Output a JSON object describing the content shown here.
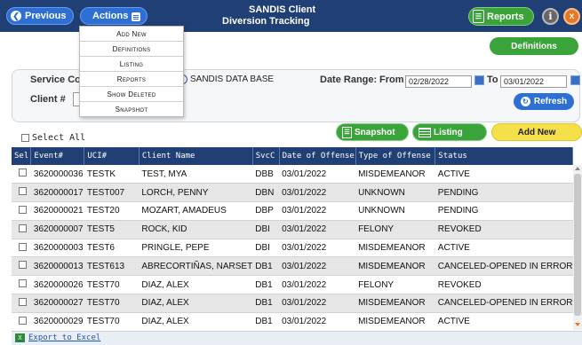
{
  "header": {
    "previous_label": "Previous",
    "actions_label": "Actions",
    "title_line1": "SANDIS Client",
    "title_line2": "Diversion Tracking",
    "reports_label": "Reports",
    "info_label": "i",
    "close_label": "x"
  },
  "actions_menu": {
    "items": [
      "Add New",
      "Definitions",
      "Listing",
      "Reports",
      "Show Deleted",
      "Snapshot"
    ]
  },
  "definitions_label": "Definitions",
  "filters": {
    "service_code_label": "Service Coo",
    "database_label": "SANDIS DATA BASE",
    "date_range_label": "Date Range:",
    "from_label": "From",
    "from_value": "02/28/2022",
    "to_label": "To",
    "to_value": "03/01/2022",
    "client_label": "Client #",
    "refresh_label": "Refresh"
  },
  "toolbar": {
    "select_all_label": "Select All",
    "snapshot_label": "Snapshot",
    "listing_label": "Listing",
    "add_new_label": "Add New"
  },
  "table": {
    "columns": [
      "Sel",
      "Event#",
      "UCI#",
      "Client Name",
      "SvcC",
      "Date of Offense",
      "Type of Offense",
      "Status"
    ],
    "rows": [
      [
        "3620000036",
        "TESTK",
        "TEST, MYA",
        "DBB",
        "03/01/2022",
        "MISDEMEANOR",
        "ACTIVE"
      ],
      [
        "3620000017",
        "TEST007",
        "LORCH, PENNY",
        "DBN",
        "03/01/2022",
        "UNKNOWN",
        "PENDING"
      ],
      [
        "3620000021",
        "TEST20",
        "MOZART, AMADEUS",
        "DBP",
        "03/01/2022",
        "UNKNOWN",
        "PENDING"
      ],
      [
        "3620000007",
        "TEST5",
        "ROCK, KID",
        "DBI",
        "03/01/2022",
        "FELONY",
        "REVOKED"
      ],
      [
        "3620000003",
        "TEST6",
        "PRINGLE, PEPE",
        "DBI",
        "03/01/2022",
        "MISDEMEANOR",
        "ACTIVE"
      ],
      [
        "3620000013",
        "TEST613",
        "ABRECORTIÑAS, NARSET",
        "DB1",
        "03/01/2022",
        "MISDEMEANOR",
        "CANCELED-OPENED IN ERROR"
      ],
      [
        "3620000026",
        "TEST70",
        "DIAZ, ALEX",
        "DB1",
        "03/01/2022",
        "FELONY",
        "REVOKED"
      ],
      [
        "3620000027",
        "TEST70",
        "DIAZ, ALEX",
        "DB1",
        "03/01/2022",
        "MISDEMEANOR",
        "CANCELED-OPENED IN ERROR"
      ],
      [
        "3620000029",
        "TEST70",
        "DIAZ, ALEX",
        "DB1",
        "03/01/2022",
        "MISDEMEANOR",
        "ACTIVE"
      ]
    ]
  },
  "footer": {
    "export_label": "Export to Excel"
  },
  "colors": {
    "header_bg": "#1f3f75",
    "primary_blue": "#2e6fd6",
    "green": "#3aa33a",
    "yellow": "#f5e04a",
    "orange": "#e87722"
  }
}
